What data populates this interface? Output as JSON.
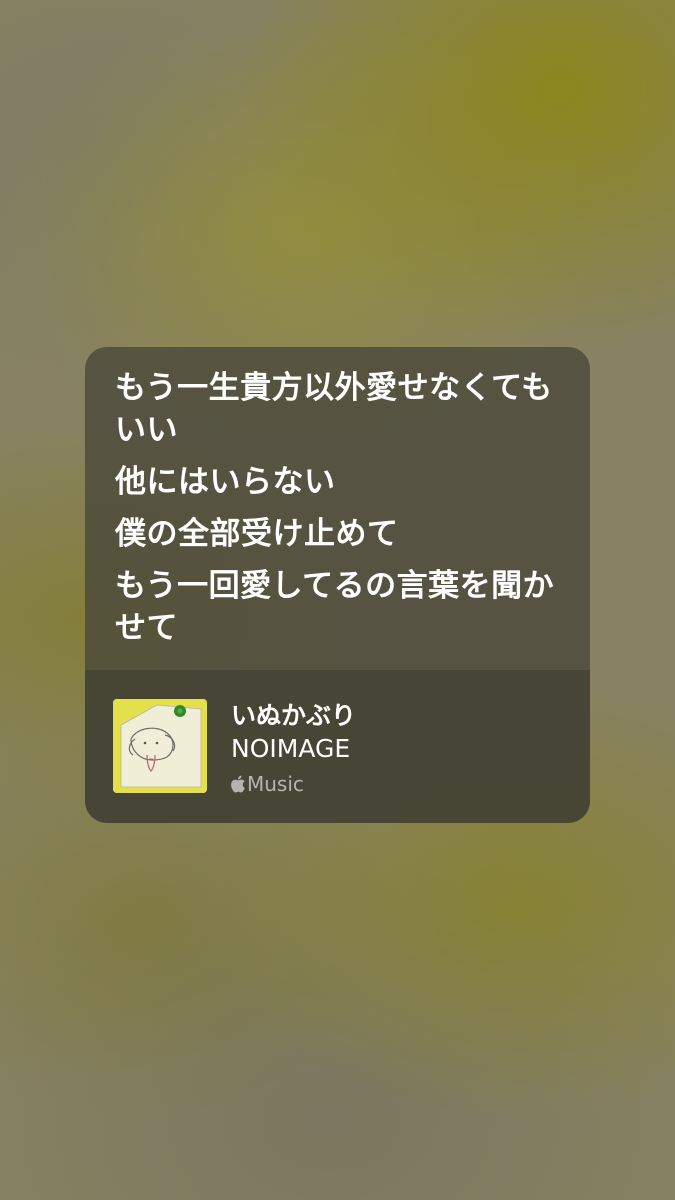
{
  "lyrics": {
    "lines": [
      "もう一生貴方以外愛せなくてもいい",
      "他にはいらない",
      "僕の全部受け止めて",
      "もう一回愛してるの言葉を聞かせて"
    ]
  },
  "track": {
    "title": "いぬかぶり",
    "artist": "NOIMAGE",
    "service_label": "Music",
    "service_icon": "apple-icon",
    "artwork_icon": "dog-drawing-artwork"
  },
  "colors": {
    "background": "#888262",
    "artwork_bg": "#e3e04c",
    "pin": "#2f8a2a"
  }
}
